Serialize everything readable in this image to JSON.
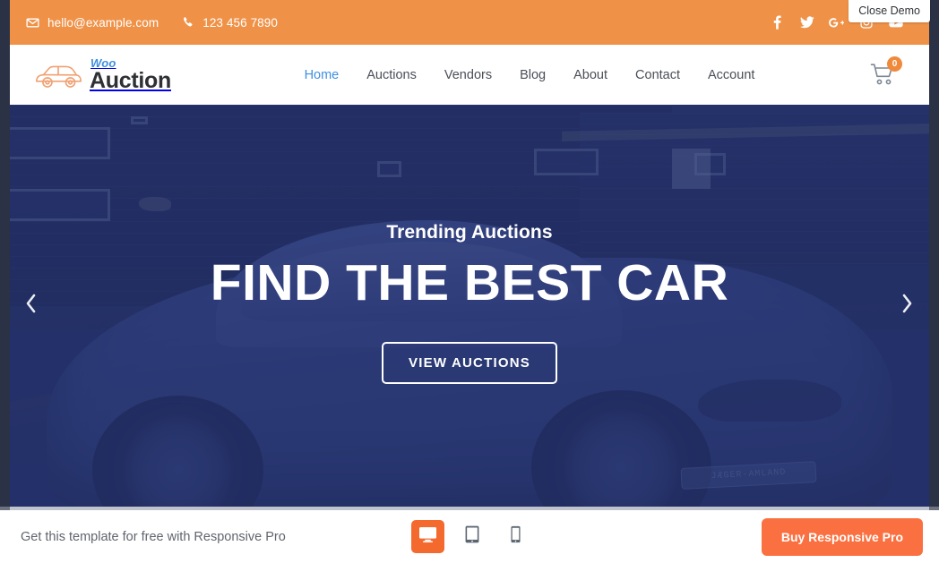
{
  "overlay": {
    "close_demo_label": "Close Demo"
  },
  "topbar": {
    "email": "hello@example.com",
    "phone": "123 456 7890",
    "email_icon": "envelope-icon",
    "phone_icon": "phone-icon",
    "background": "#ef9248",
    "social": [
      {
        "name": "facebook",
        "label": "f"
      },
      {
        "name": "twitter",
        "label": "t"
      },
      {
        "name": "google-plus",
        "label": "G+"
      },
      {
        "name": "instagram",
        "label": "ig"
      },
      {
        "name": "youtube",
        "label": "yt"
      }
    ]
  },
  "header": {
    "logo": {
      "mark": "car-icon",
      "woo": "Woo",
      "auction": "Auction",
      "woo_color": "#3f8fe0",
      "auction_color": "#2f3033"
    },
    "nav": [
      {
        "label": "Home",
        "active": true
      },
      {
        "label": "Auctions",
        "active": false
      },
      {
        "label": "Vendors",
        "active": false
      },
      {
        "label": "Blog",
        "active": false
      },
      {
        "label": "About",
        "active": false
      },
      {
        "label": "Contact",
        "active": false
      },
      {
        "label": "Account",
        "active": false
      }
    ],
    "cart": {
      "icon": "shopping-cart-icon",
      "count": "0",
      "badge_color": "#ef8a3c"
    }
  },
  "hero": {
    "subtitle": "Trending Auctions",
    "title": "FIND THE BEST CAR",
    "button_label": "VIEW AUCTIONS",
    "prev_icon": "chevron-left-icon",
    "next_icon": "chevron-right-icon",
    "overlay_color": "#243169",
    "photo": {
      "description": "sports car parked on a hillside in front of a wooden house",
      "license_plate": "JÆGER-AMLAND"
    }
  },
  "demobar": {
    "text": "Get this template for free with Responsive Pro",
    "devices": [
      {
        "name": "desktop",
        "icon": "desktop-icon",
        "active": true
      },
      {
        "name": "tablet",
        "icon": "tablet-icon",
        "active": false
      },
      {
        "name": "mobile",
        "icon": "mobile-icon",
        "active": false
      }
    ],
    "buy_label": "Buy Responsive Pro",
    "buy_color": "#fa7040",
    "active_device_color": "#f4692e"
  }
}
